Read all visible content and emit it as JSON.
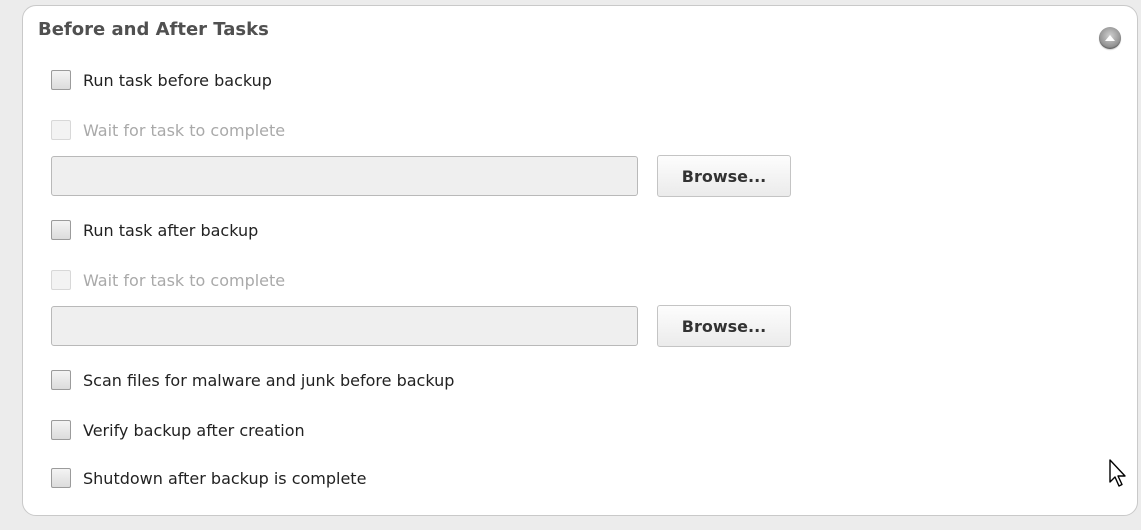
{
  "panel": {
    "title": "Before and After Tasks",
    "collapse_icon": "chevron-up-icon"
  },
  "before": {
    "run_task_label": "Run task before backup",
    "run_task_checked": false,
    "wait_label": "Wait for task to complete",
    "wait_enabled": false,
    "path_value": "",
    "browse_label": "Browse..."
  },
  "after": {
    "run_task_label": "Run task after backup",
    "run_task_checked": false,
    "wait_label": "Wait for task to complete",
    "wait_enabled": false,
    "path_value": "",
    "browse_label": "Browse..."
  },
  "options": {
    "scan_label": "Scan files for malware and junk before backup",
    "verify_label": "Verify backup after creation",
    "shutdown_label": "Shutdown after backup is complete"
  },
  "colors": {
    "panel_background": "#ffffff",
    "page_background": "#ececec",
    "title_color": "#505050",
    "disabled_text": "#a9a9a9"
  },
  "cursor_icon": "mouse-pointer-icon"
}
